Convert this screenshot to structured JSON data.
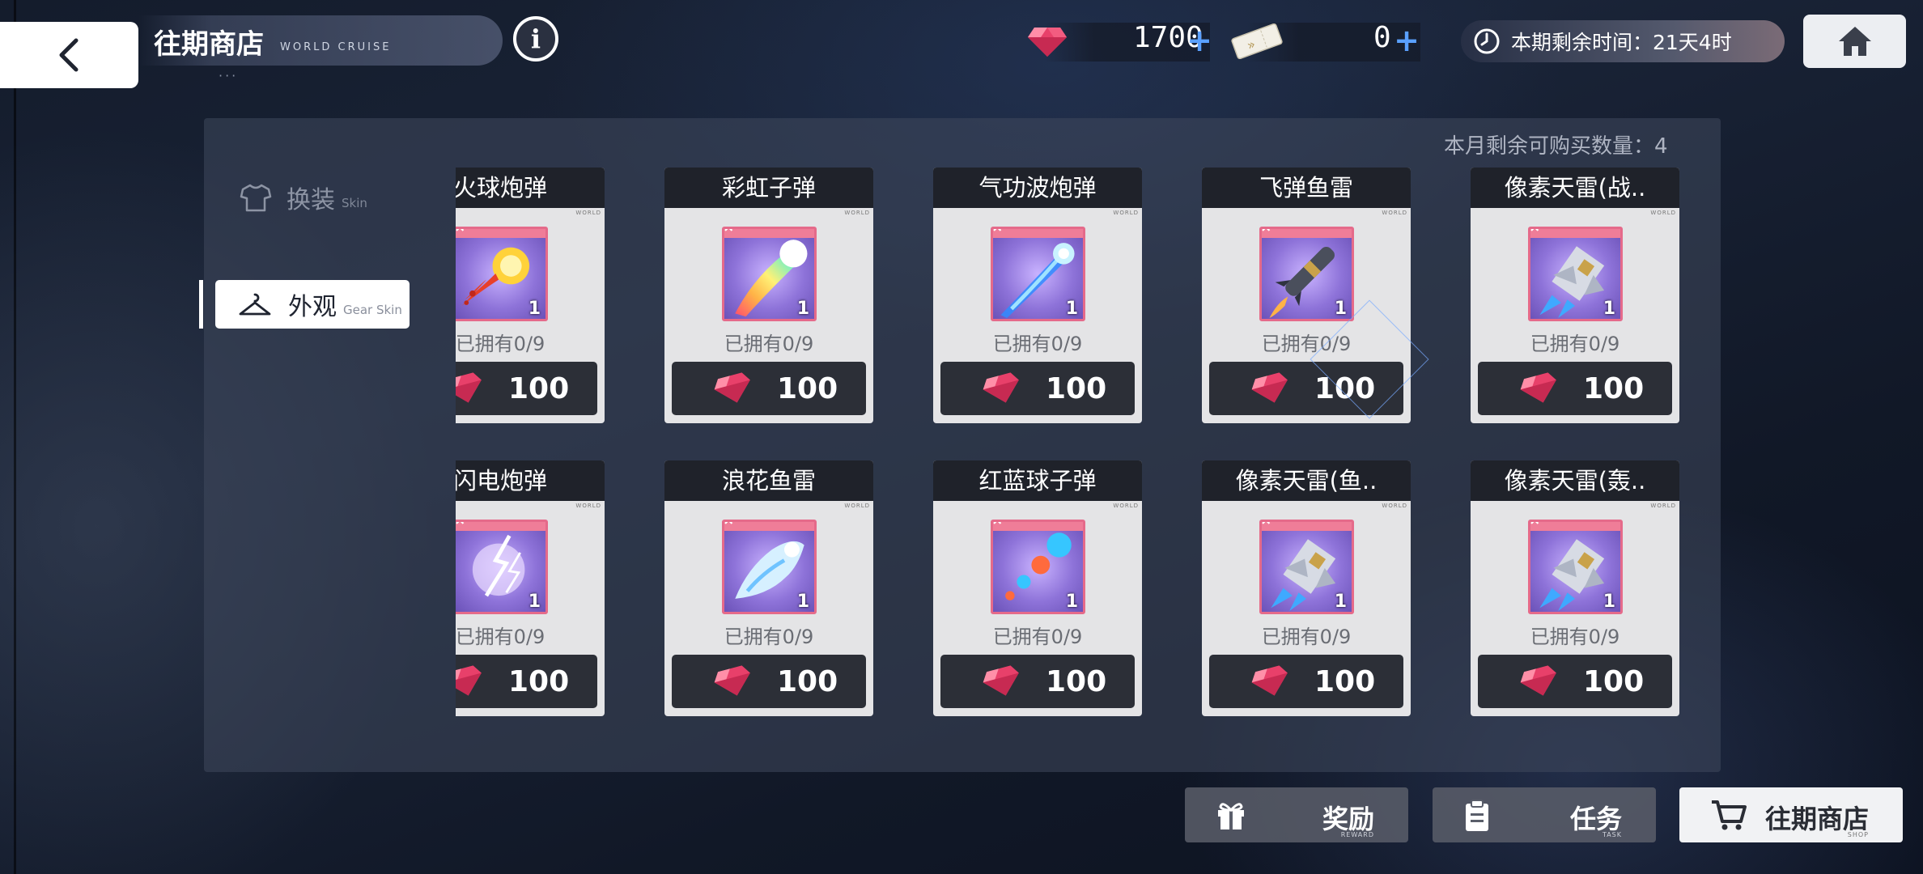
{
  "header": {
    "title": "往期商店",
    "subtitle": "WORLD CRUISE",
    "dots": "···",
    "info_label": "i"
  },
  "currency": {
    "gems": {
      "value": "1700",
      "plus": "+"
    },
    "tickets": {
      "value": "0",
      "plus": "+"
    }
  },
  "timer": {
    "text": "本期剩余时间：21天4时"
  },
  "panel": {
    "remaining_purchases": "本月剩余可购买数量：4"
  },
  "sidebar": {
    "items": [
      {
        "label": "换装",
        "sub": "Skin",
        "active": false
      },
      {
        "label": "外观",
        "sub": "Gear Skin",
        "active": true
      }
    ]
  },
  "items": [
    {
      "name": "火球炮弹",
      "owned": "已拥有0/9",
      "price": "100",
      "qty": "1",
      "art": "fireball-art"
    },
    {
      "name": "彩虹子弹",
      "owned": "已拥有0/9",
      "price": "100",
      "qty": "1",
      "art": "rainbow-bullet-art"
    },
    {
      "name": "气功波炮弹",
      "owned": "已拥有0/9",
      "price": "100",
      "qty": "1",
      "art": "energy-wave-art"
    },
    {
      "name": "飞弹鱼雷",
      "owned": "已拥有0/9",
      "price": "100",
      "qty": "1",
      "art": "missile-art"
    },
    {
      "name": "像素天雷(战..",
      "owned": "已拥有0/9",
      "price": "100",
      "qty": "1",
      "art": "pixel-jet-art"
    },
    {
      "name": "闪电炮弹",
      "owned": "已拥有0/9",
      "price": "100",
      "qty": "1",
      "art": "lightning-art"
    },
    {
      "name": "浪花鱼雷",
      "owned": "已拥有0/9",
      "price": "100",
      "qty": "1",
      "art": "wave-torpedo-art"
    },
    {
      "name": "红蓝球子弹",
      "owned": "已拥有0/9",
      "price": "100",
      "qty": "1",
      "art": "red-blue-balls-art"
    },
    {
      "name": "像素天雷(鱼..",
      "owned": "已拥有0/9",
      "price": "100",
      "qty": "1",
      "art": "pixel-jet-art"
    },
    {
      "name": "像素天雷(轰..",
      "owned": "已拥有0/9",
      "price": "100",
      "qty": "1",
      "art": "pixel-jet-art"
    }
  ],
  "card_world_tag": "WORLD",
  "bottom_tabs": [
    {
      "label": "奖励",
      "sub": "REWARD",
      "icon": "gift-icon",
      "active": false
    },
    {
      "label": "任务",
      "sub": "TASK",
      "icon": "clipboard-icon",
      "active": false
    },
    {
      "label": "往期商店",
      "sub": "SHOP",
      "icon": "cart-icon",
      "active": true
    }
  ],
  "colors": {
    "gem": "#e8406a",
    "accent_plus": "#5aa0ff",
    "card_frame": "#e56a8a"
  }
}
